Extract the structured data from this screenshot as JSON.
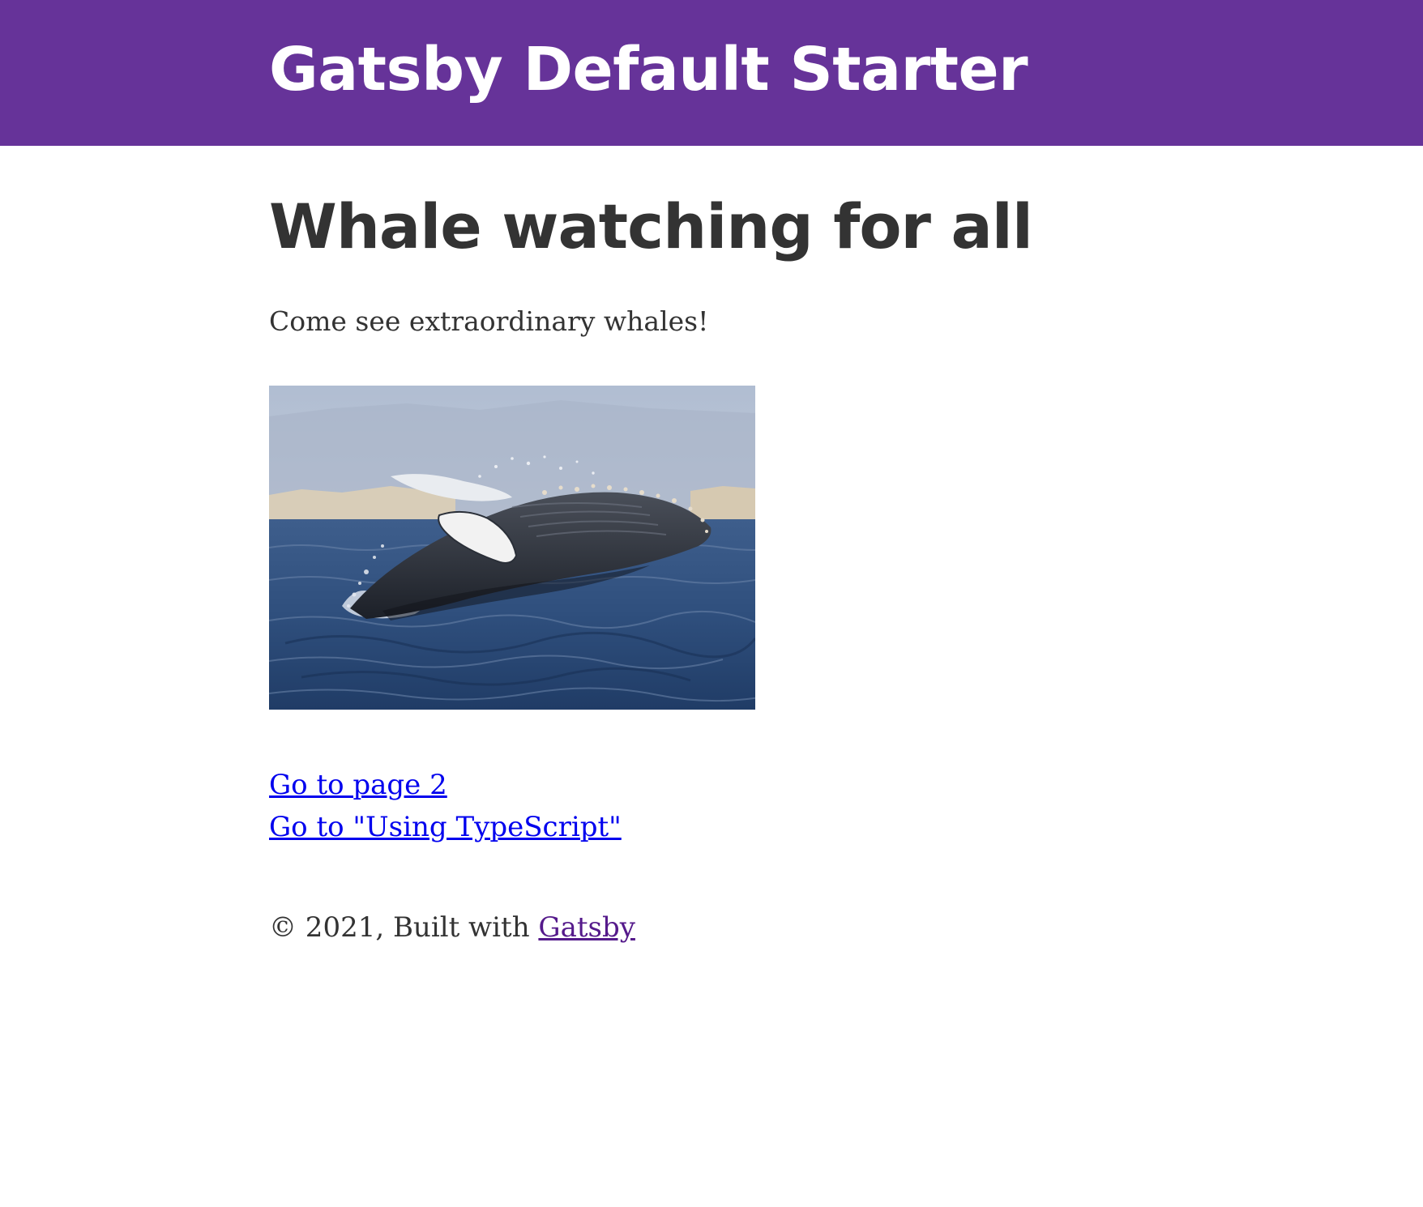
{
  "header": {
    "site_title": "Gatsby Default Starter",
    "background_color": "#663399"
  },
  "main": {
    "heading": "Whale watching for all",
    "intro": "Come see extraordinary whales!",
    "image": {
      "subject": "humpback whale breaching from the ocean"
    },
    "links": [
      {
        "label": "Go to page 2"
      },
      {
        "label": "Go to \"Using TypeScript\""
      }
    ]
  },
  "footer": {
    "prefix": "© 2021, Built with ",
    "link_label": "Gatsby"
  }
}
